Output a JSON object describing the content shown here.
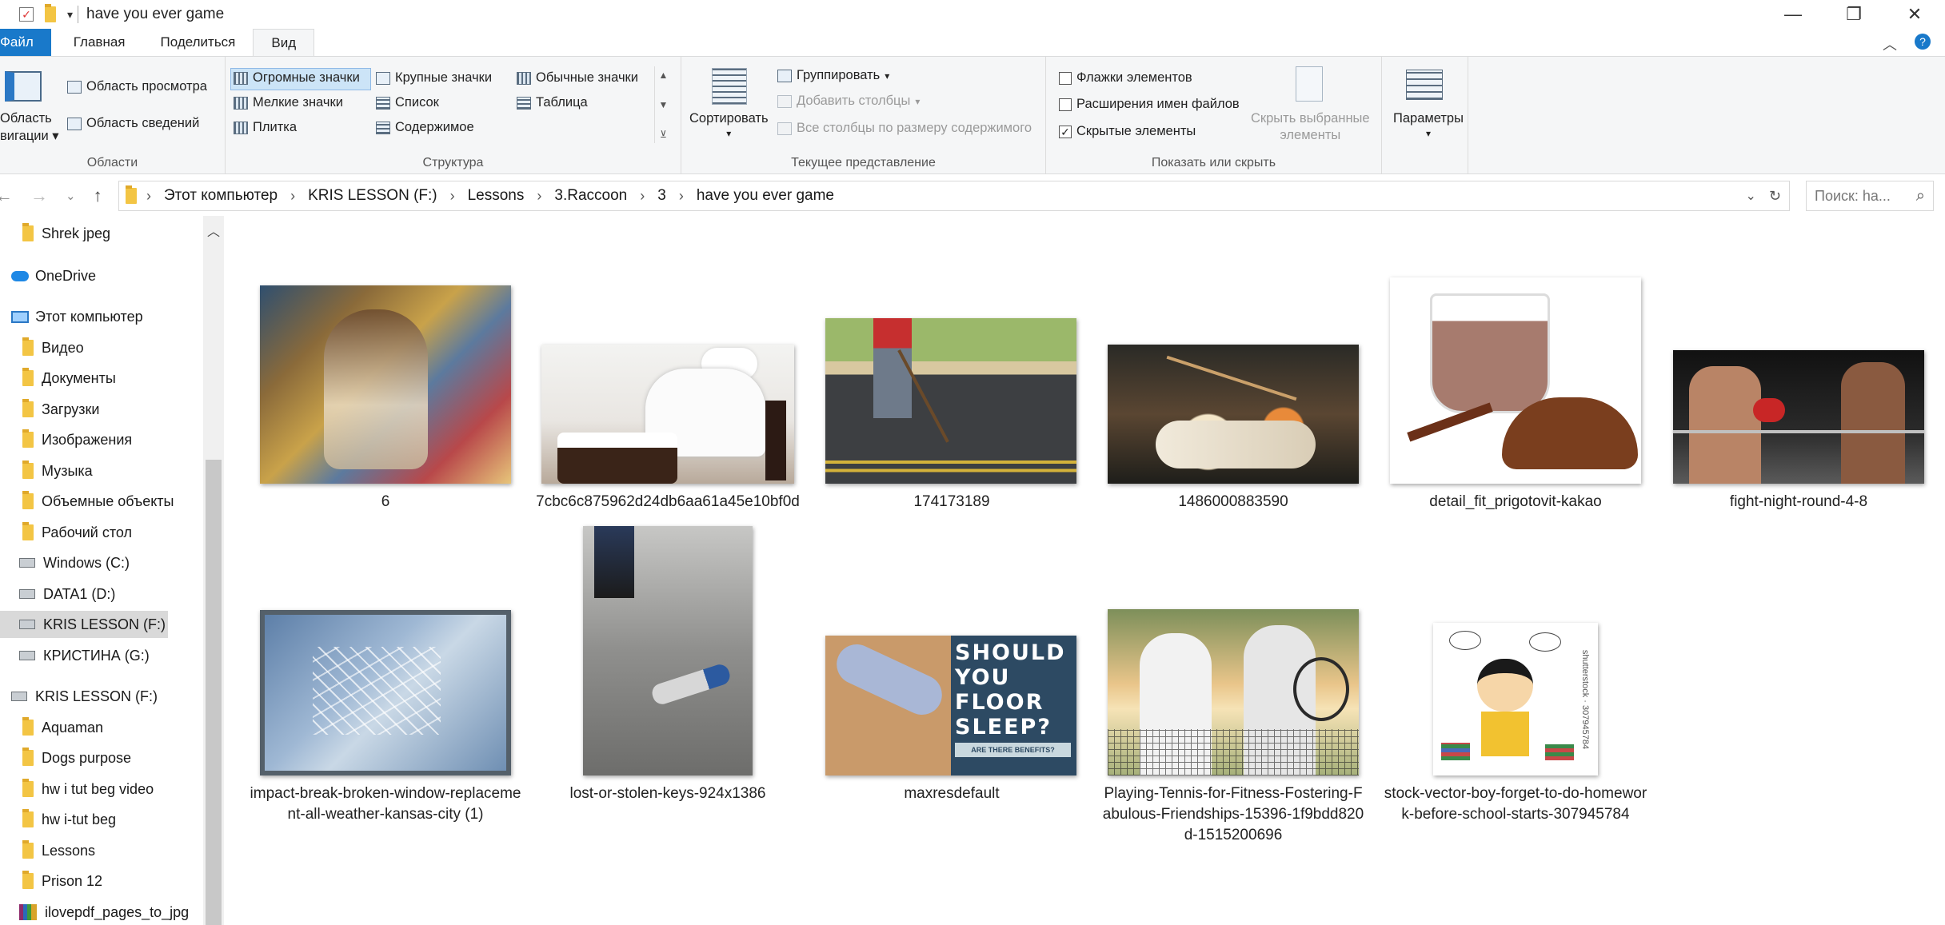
{
  "window": {
    "title": "have you ever game",
    "controls": {
      "minimize": "—",
      "maximize": "❐",
      "close": "✕"
    }
  },
  "ribbon_tabs": [
    "Файл",
    "Главная",
    "Поделиться",
    "Вид"
  ],
  "ribbon": {
    "panes": {
      "label": "Области",
      "nav_pane_line1": "Область",
      "nav_pane_line2": "вигации",
      "preview_pane": "Область просмотра",
      "details_pane": "Область сведений"
    },
    "layout": {
      "label": "Структура",
      "items": [
        "Огромные значки",
        "Крупные значки",
        "Обычные значки",
        "Мелкие значки",
        "Список",
        "Таблица",
        "Плитка",
        "Содержимое"
      ]
    },
    "current_view": {
      "label": "Текущее представление",
      "sort": "Сортировать",
      "group_by": "Группировать",
      "add_columns": "Добавить столбцы",
      "size_columns": "Все столбцы по размеру содержимого"
    },
    "show_hide": {
      "label": "Показать или скрыть",
      "item_checkboxes": "Флажки элементов",
      "file_extensions": "Расширения имен файлов",
      "hidden_items": "Скрытые элементы",
      "hide_selected_line1": "Скрыть выбранные",
      "hide_selected_line2": "элементы"
    },
    "options": "Параметры"
  },
  "address": {
    "crumbs": [
      "Этот компьютер",
      "KRIS LESSON (F:)",
      "Lessons",
      "3.Raccoon",
      "3",
      "have you ever game"
    ],
    "search_placeholder": "Поиск: ha..."
  },
  "nav_pane": {
    "items": [
      {
        "label": "Shrek jpeg",
        "icon": "folder"
      },
      {
        "label": "OneDrive",
        "icon": "cloud"
      },
      {
        "label": "Этот компьютер",
        "icon": "pc"
      },
      {
        "label": "Видео",
        "icon": "folder"
      },
      {
        "label": "Документы",
        "icon": "folder"
      },
      {
        "label": "Загрузки",
        "icon": "folder"
      },
      {
        "label": "Изображения",
        "icon": "folder"
      },
      {
        "label": "Музыка",
        "icon": "folder"
      },
      {
        "label": "Объемные объекты",
        "icon": "folder"
      },
      {
        "label": "Рабочий стол",
        "icon": "folder"
      },
      {
        "label": "Windows (C:)",
        "icon": "drive"
      },
      {
        "label": "DATA1 (D:)",
        "icon": "drive"
      },
      {
        "label": "KRIS LESSON (F:)",
        "icon": "drive",
        "selected": true
      },
      {
        "label": "КРИСТИНА (G:)",
        "icon": "drive"
      },
      {
        "label": "KRIS LESSON (F:)",
        "icon": "drive"
      },
      {
        "label": "Aquaman",
        "icon": "folder"
      },
      {
        "label": "Dogs purpose",
        "icon": "folder"
      },
      {
        "label": "hw i tut beg video",
        "icon": "folder"
      },
      {
        "label": "hw i-tut beg",
        "icon": "folder"
      },
      {
        "label": "Lessons",
        "icon": "folder"
      },
      {
        "label": "Prison 12",
        "icon": "folder"
      },
      {
        "label": "ilovepdf_pages_to_jpg",
        "icon": "archive"
      }
    ]
  },
  "files": [
    {
      "name": "6"
    },
    {
      "name": "7cbc6c875962d24db6aa61a45e10bf0d"
    },
    {
      "name": "174173189"
    },
    {
      "name": "1486000883590"
    },
    {
      "name": "detail_fit_prigotovit-kakao"
    },
    {
      "name": "fight-night-round-4-8"
    },
    {
      "name": "impact-break-broken-window-replacement-all-weather-kansas-city (1)"
    },
    {
      "name": "lost-or-stolen-keys-924x1386"
    },
    {
      "name": "maxresdefault",
      "image_text": [
        "SHOULD",
        "YOU",
        "FLOOR",
        "SLEEP?",
        "ARE THERE BENEFITS?"
      ]
    },
    {
      "name": "Playing-Tennis-for-Fitness-Fostering-Fabulous-Friendships-15396-1f9bdd820d-1515200696"
    },
    {
      "name": "stock-vector-boy-forget-to-do-homework-before-school-starts-307945784",
      "image_text": [
        "shutterstock · 307945784"
      ]
    }
  ],
  "colors": {
    "file_tab": "#1979ca",
    "ribbon_bg": "#f5f6f7",
    "selection": "#cce4f7",
    "nav_selected": "#d9d9d9"
  }
}
